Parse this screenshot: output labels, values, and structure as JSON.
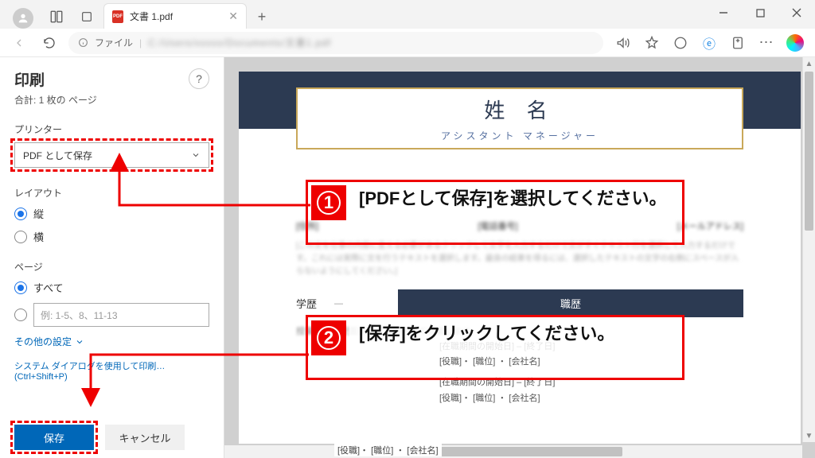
{
  "window": {
    "tab_title": "文書 1.pdf",
    "addr_label": "ファイル"
  },
  "print": {
    "title": "印刷",
    "page_count": "合計: 1 枚の ページ",
    "printer_label": "プリンター",
    "printer_value": "PDF として保存",
    "layout_label": "レイアウト",
    "layout_portrait": "縦",
    "layout_landscape": "横",
    "pages_label": "ページ",
    "pages_all": "すべて",
    "pages_range_placeholder": "例: 1-5、8、11-13",
    "more_settings": "その他の設定",
    "system_dialog": "システム ダイアログを使用して印刷… (Ctrl+Shift+P)",
    "save_btn": "保存",
    "cancel_btn": "キャンセル"
  },
  "doc": {
    "name": "姓 名",
    "subtitle": "アシスタント マネージャー",
    "field_address": "[住所]",
    "field_phone": "[電話番号]",
    "field_email": "[メールアドレス]",
    "section_edu": "学歴",
    "section_exp": "職歴",
    "desc1": "[この文を仕事の内容に変える必要があるクリックして文字を入力するだけで文がすぐテキスト行を選択して入力するだけです。これには実際に文を行うテキストを選択します。最良の結果を得るには、選択したテキストの文字の右側にスペースが入らないようにしてください。]",
    "detail1": "[在職期間の開始日] – [終了日]",
    "detail2": "[役職]・ [職位] ・ [会社名]",
    "detail3": "[在職期間の開始日] – [終了日]",
    "detail4": "[役職]・ [職位] ・ [会社名]",
    "footer": "[役職]・ [職位] ・ [会社名]"
  },
  "annotations": {
    "a1": "[PDFとして保存]を選択してください。",
    "a2": "[保存]をクリックしてください。"
  }
}
